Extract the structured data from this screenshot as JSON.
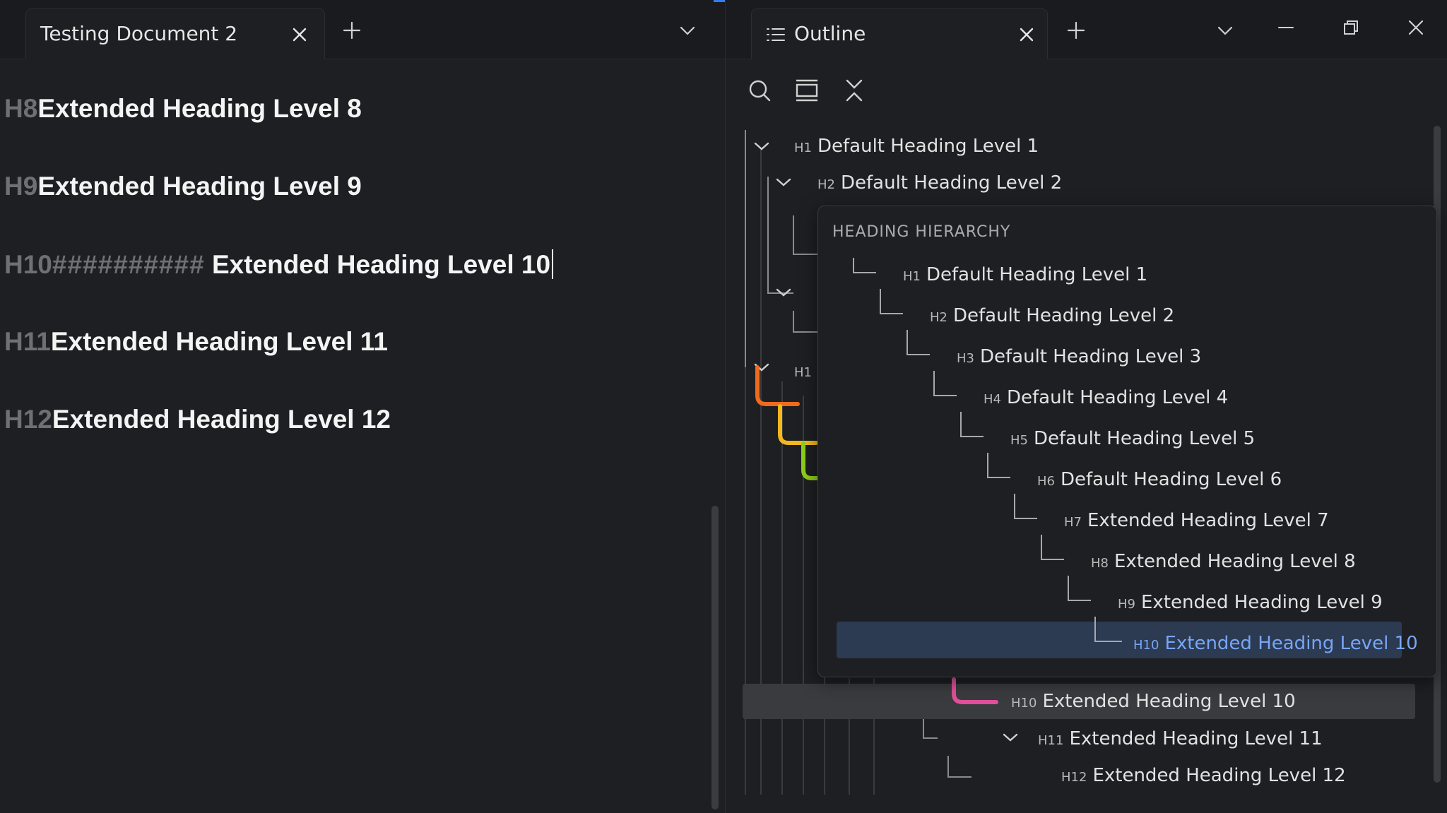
{
  "left_tab": {
    "title": "Testing Document 2"
  },
  "document": {
    "lines": [
      {
        "prefix": "H8",
        "text": "Extended Heading Level 8"
      },
      {
        "prefix": "H9",
        "text": "Extended Heading Level 9"
      },
      {
        "prefix": "H10",
        "hashes": "##########",
        "text": " Extended Heading Level 10"
      },
      {
        "prefix": "H11",
        "text": "Extended Heading Level 11"
      },
      {
        "prefix": "H12",
        "text": "Extended Heading Level 12"
      }
    ]
  },
  "right_tab": {
    "title": "Outline"
  },
  "outline": {
    "items": [
      {
        "level": "H1",
        "text": "Default Heading Level 1"
      },
      {
        "level": "H2",
        "text": "Default Heading Level 2"
      },
      {
        "level": "H1",
        "text": ""
      },
      {
        "level": "H10",
        "text": "Extended Heading Level 10"
      },
      {
        "level": "H11",
        "text": "Extended Heading Level 11"
      },
      {
        "level": "H12",
        "text": "Extended Heading Level 12"
      }
    ]
  },
  "popup": {
    "title": "HEADING HIERARCHY",
    "items": [
      {
        "level": "H1",
        "text": "Default Heading Level 1"
      },
      {
        "level": "H2",
        "text": "Default Heading Level 2"
      },
      {
        "level": "H3",
        "text": "Default Heading Level 3"
      },
      {
        "level": "H4",
        "text": "Default Heading Level 4"
      },
      {
        "level": "H5",
        "text": "Default Heading Level 5"
      },
      {
        "level": "H6",
        "text": "Default Heading Level 6"
      },
      {
        "level": "H7",
        "text": "Extended Heading Level 7"
      },
      {
        "level": "H8",
        "text": "Extended Heading Level 8"
      },
      {
        "level": "H9",
        "text": "Extended Heading Level 9"
      },
      {
        "level": "H10",
        "text": "Extended Heading Level 10"
      }
    ]
  },
  "colors": {
    "accent": "#2f7ff0",
    "active_item": "#78a6f5",
    "guide_orange": "#f06a1e",
    "guide_yellow": "#f2b81c",
    "guide_green": "#8ccf1a",
    "guide_pink": "#e0509a"
  },
  "icons": [
    "close-icon",
    "plus-icon",
    "chevron-down-icon",
    "list-icon",
    "search-icon",
    "expand-icon",
    "collapse-all-icon",
    "minimize-icon",
    "restore-icon"
  ]
}
